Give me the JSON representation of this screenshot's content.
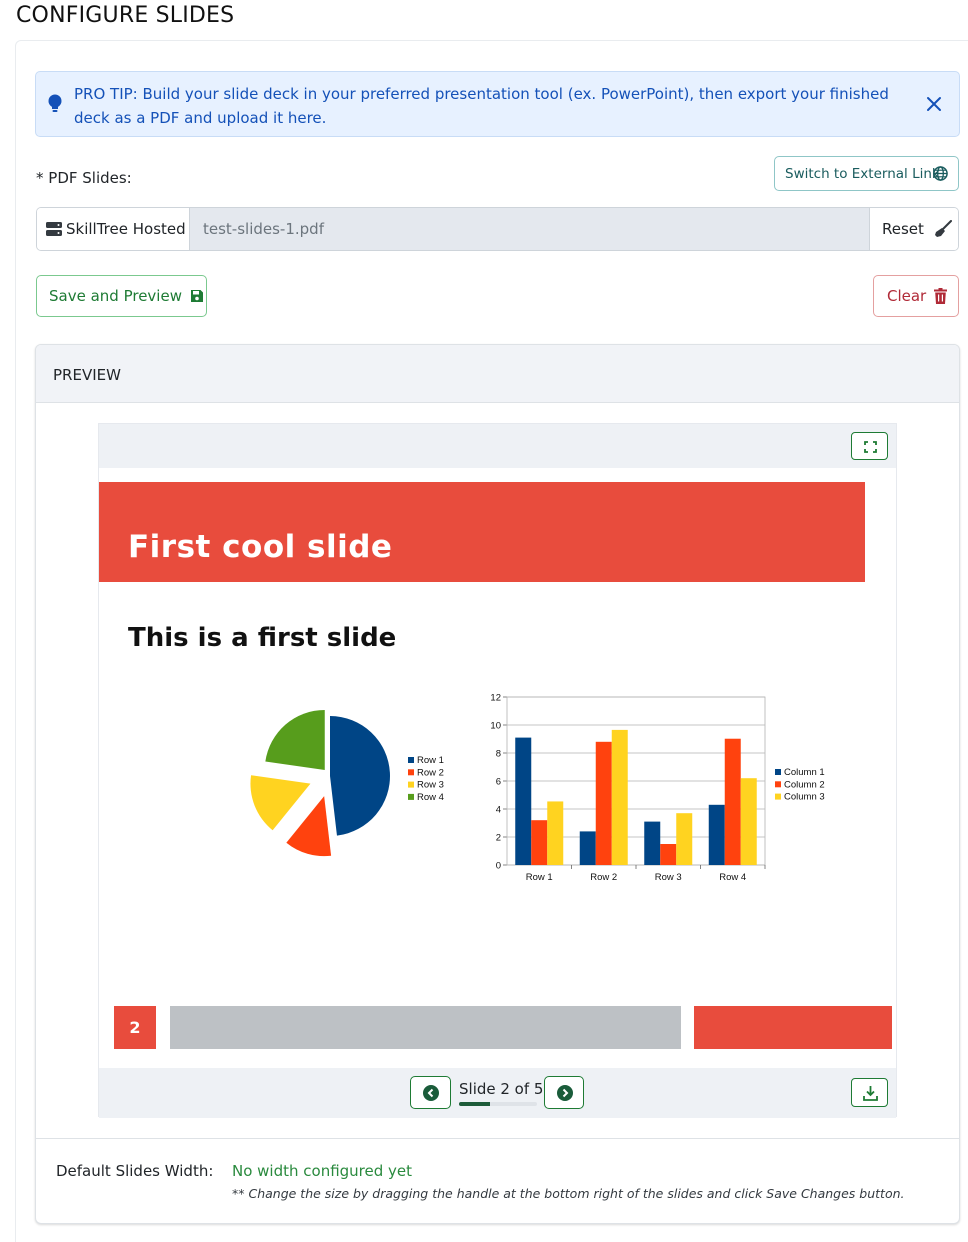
{
  "page": {
    "title": "CONFIGURE SLIDES"
  },
  "alert": {
    "text": "PRO TIP: Build your slide deck in your preferred presentation tool (ex. PowerPoint), then export your finished deck as a PDF and upload it here.",
    "icon": "lightbulb-icon",
    "close_icon": "close-icon"
  },
  "pdf": {
    "label": "* PDF Slides:",
    "switch_label": "Switch to External Link",
    "source_label": "SkillTree Hosted",
    "file_name": "test-slides-1.pdf",
    "reset_label": "Reset"
  },
  "actions": {
    "save_label": "Save and Preview",
    "clear_label": "Clear"
  },
  "preview": {
    "header": "PREVIEW",
    "slide": {
      "title": "First cool slide",
      "subtitle": "This is a first slide",
      "footer_number": "2"
    },
    "navigation": {
      "label": "Slide 2 of 5",
      "current": 2,
      "total": 5,
      "progress_fraction": 0.4
    }
  },
  "settings": {
    "width_label": "Default Slides Width:",
    "width_value": "No width configured yet",
    "width_hint": "** Change the size by dragging the handle at the bottom right of the slides and click Save Changes button."
  },
  "colors": {
    "accent_red": "#e84c3d",
    "success_green": "#1e7b34",
    "info_blue": "#1451b8"
  },
  "chart_data": [
    {
      "type": "pie",
      "categories": [
        "Row 1",
        "Row 2",
        "Row 3",
        "Row 4"
      ],
      "values": [
        9.1,
        2.4,
        3.1,
        4.3
      ],
      "colors": [
        "#004586",
        "#ff420e",
        "#ffd320",
        "#579d1c"
      ],
      "legend": "right"
    },
    {
      "type": "bar",
      "categories": [
        "Row 1",
        "Row 2",
        "Row 3",
        "Row 4"
      ],
      "series": [
        {
          "name": "Column 1",
          "values": [
            9.1,
            2.4,
            3.1,
            4.3
          ]
        },
        {
          "name": "Column 2",
          "values": [
            3.2,
            8.8,
            1.5,
            9.02
          ]
        },
        {
          "name": "Column 3",
          "values": [
            4.54,
            9.65,
            3.7,
            6.2
          ]
        }
      ],
      "colors": [
        "#004586",
        "#ff420e",
        "#ffd320"
      ],
      "ylim": [
        0,
        12
      ],
      "yticks": [
        0,
        2,
        4,
        6,
        8,
        10,
        12
      ],
      "grid": true,
      "legend": "right"
    }
  ]
}
